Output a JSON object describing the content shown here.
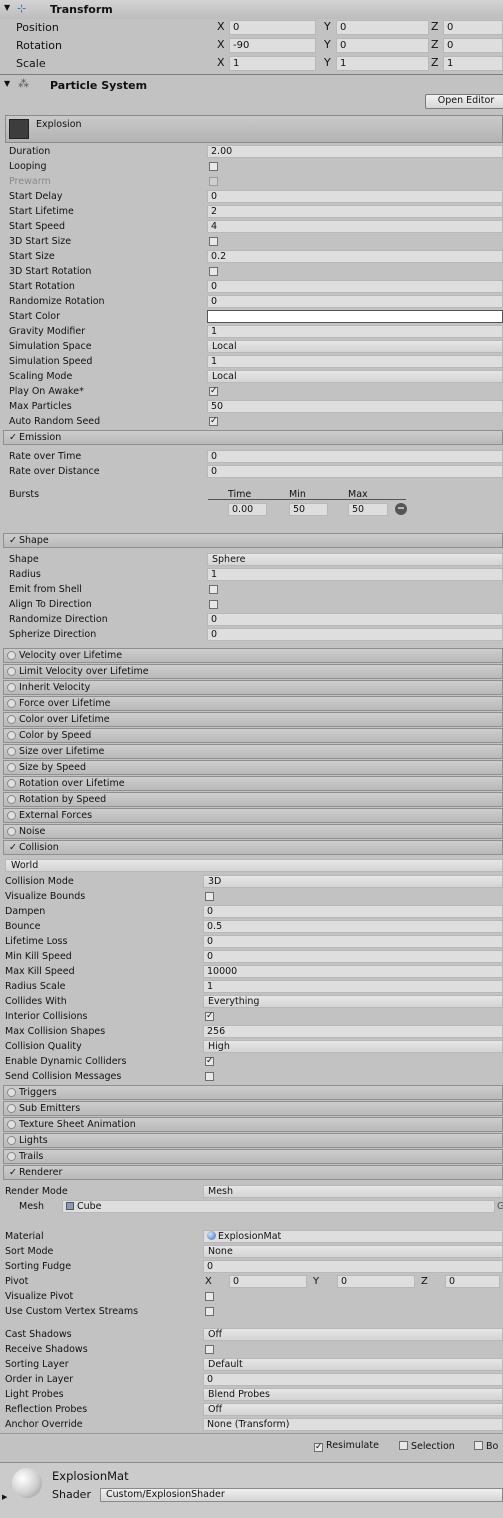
{
  "transform": {
    "title": "Transform",
    "rows": [
      {
        "label": "Position",
        "x": "0",
        "y": "0",
        "z": "0"
      },
      {
        "label": "Rotation",
        "x": "-90",
        "y": "0",
        "z": "0"
      },
      {
        "label": "Scale",
        "x": "1",
        "y": "1",
        "z": "1"
      }
    ],
    "axis": {
      "x": "X",
      "y": "Y",
      "z": "Z"
    }
  },
  "ps": {
    "title": "Particle System",
    "open_editor": "Open Editor",
    "system_name": "Explosion",
    "main": [
      {
        "label": "Duration",
        "type": "text",
        "value": "2.00"
      },
      {
        "label": "Looping",
        "type": "check",
        "checked": false
      },
      {
        "label": "Prewarm",
        "type": "check",
        "checked": false,
        "disabled": true
      },
      {
        "label": "Start Delay",
        "type": "text",
        "value": "0"
      },
      {
        "label": "Start Lifetime",
        "type": "text",
        "value": "2"
      },
      {
        "label": "Start Speed",
        "type": "text",
        "value": "4"
      },
      {
        "label": "3D Start Size",
        "type": "check",
        "checked": false
      },
      {
        "label": "Start Size",
        "type": "text",
        "value": "0.2"
      },
      {
        "label": "3D Start Rotation",
        "type": "check",
        "checked": false
      },
      {
        "label": "Start Rotation",
        "type": "text",
        "value": "0"
      },
      {
        "label": "Randomize Rotation",
        "type": "text",
        "value": "0"
      },
      {
        "label": "Start Color",
        "type": "color",
        "value": "#ffffff"
      },
      {
        "label": "Gravity Modifier",
        "type": "text",
        "value": "1"
      },
      {
        "label": "Simulation Space",
        "type": "drop",
        "value": "Local"
      },
      {
        "label": "Simulation Speed",
        "type": "text",
        "value": "1"
      },
      {
        "label": "Scaling Mode",
        "type": "drop",
        "value": "Local"
      },
      {
        "label": "Play On Awake*",
        "type": "check",
        "checked": true
      },
      {
        "label": "Max Particles",
        "type": "text",
        "value": "50"
      },
      {
        "label": "Auto Random Seed",
        "type": "check",
        "checked": true
      }
    ],
    "emission": {
      "title": "Emission",
      "rows": [
        {
          "label": "Rate over Time",
          "value": "0"
        },
        {
          "label": "Rate over Distance",
          "value": "0"
        }
      ],
      "bursts_label": "Bursts",
      "burst_headers": [
        "Time",
        "Min",
        "Max"
      ],
      "burst": [
        "0.00",
        "50",
        "50"
      ]
    },
    "shape": {
      "title": "Shape",
      "rows": [
        {
          "label": "Shape",
          "type": "drop",
          "value": "Sphere"
        },
        {
          "label": "Radius",
          "type": "text",
          "value": "1"
        },
        {
          "label": "Emit from Shell",
          "type": "check",
          "checked": false
        },
        {
          "label": "Align To Direction",
          "type": "check",
          "checked": false
        },
        {
          "label": "Randomize Direction",
          "type": "text",
          "value": "0"
        },
        {
          "label": "Spherize Direction",
          "type": "text",
          "value": "0"
        }
      ]
    },
    "modules_a": [
      "Velocity over Lifetime",
      "Limit Velocity over Lifetime",
      "Inherit Velocity",
      "Force over Lifetime",
      "Color over Lifetime",
      "Color by Speed",
      "Size over Lifetime",
      "Size by Speed",
      "Rotation over Lifetime",
      "Rotation by Speed",
      "External Forces",
      "Noise"
    ],
    "collision": {
      "title": "Collision",
      "type": "World",
      "rows": [
        {
          "label": "Collision Mode",
          "type": "drop",
          "value": "3D"
        },
        {
          "label": "Visualize Bounds",
          "type": "check",
          "checked": false
        },
        {
          "label": "Dampen",
          "type": "text",
          "value": "0"
        },
        {
          "label": "Bounce",
          "type": "text",
          "value": "0.5"
        },
        {
          "label": "Lifetime Loss",
          "type": "text",
          "value": "0"
        },
        {
          "label": "Min Kill Speed",
          "type": "text",
          "value": "0"
        },
        {
          "label": "Max Kill Speed",
          "type": "text",
          "value": "10000"
        },
        {
          "label": "Radius Scale",
          "type": "text",
          "value": "1"
        },
        {
          "label": "Collides With",
          "type": "drop",
          "value": "Everything"
        },
        {
          "label": "Interior Collisions",
          "type": "check",
          "checked": true
        },
        {
          "label": "Max Collision Shapes",
          "type": "text",
          "value": "256"
        },
        {
          "label": "Collision Quality",
          "type": "drop",
          "value": "High"
        },
        {
          "label": "Enable Dynamic Colliders",
          "type": "check",
          "checked": true
        },
        {
          "label": "Send Collision Messages",
          "type": "check",
          "checked": false
        }
      ]
    },
    "modules_b": [
      "Triggers",
      "Sub Emitters",
      "Texture Sheet Animation",
      "Lights",
      "Trails"
    ],
    "renderer": {
      "title": "Renderer",
      "render_mode_label": "Render Mode",
      "render_mode": "Mesh",
      "mesh_label": "Mesh",
      "mesh": "Cube",
      "rows": [
        {
          "label": "Material",
          "type": "obj",
          "value": "ExplosionMat"
        },
        {
          "label": "Sort Mode",
          "type": "drop",
          "value": "None"
        },
        {
          "label": "Sorting Fudge",
          "type": "text",
          "value": "0"
        },
        {
          "label": "Pivot",
          "type": "xyz",
          "x": "0",
          "y": "0",
          "z": "0"
        },
        {
          "label": "Visualize Pivot",
          "type": "check",
          "checked": false
        },
        {
          "label": "Use Custom Vertex Streams",
          "type": "check",
          "checked": false
        }
      ],
      "rows2": [
        {
          "label": "Cast Shadows",
          "type": "drop",
          "value": "Off"
        },
        {
          "label": "Receive Shadows",
          "type": "check",
          "checked": false
        },
        {
          "label": "Sorting Layer",
          "type": "drop",
          "value": "Default"
        },
        {
          "label": "Order in Layer",
          "type": "text",
          "value": "0"
        },
        {
          "label": "Light Probes",
          "type": "drop",
          "value": "Blend Probes"
        },
        {
          "label": "Reflection Probes",
          "type": "drop",
          "value": "Off"
        },
        {
          "label": "Anchor Override",
          "type": "obj",
          "value": "None (Transform)"
        }
      ]
    }
  },
  "footer": {
    "resimulate": "Resimulate",
    "selection": "Selection",
    "bounds": "Bo"
  },
  "material": {
    "name": "ExplosionMat",
    "shader_label": "Shader",
    "shader": "Custom/ExplosionShader"
  },
  "colors": {
    "panel": "#c2c2c2",
    "header": "#b9b9b9",
    "field": "#dedede"
  }
}
